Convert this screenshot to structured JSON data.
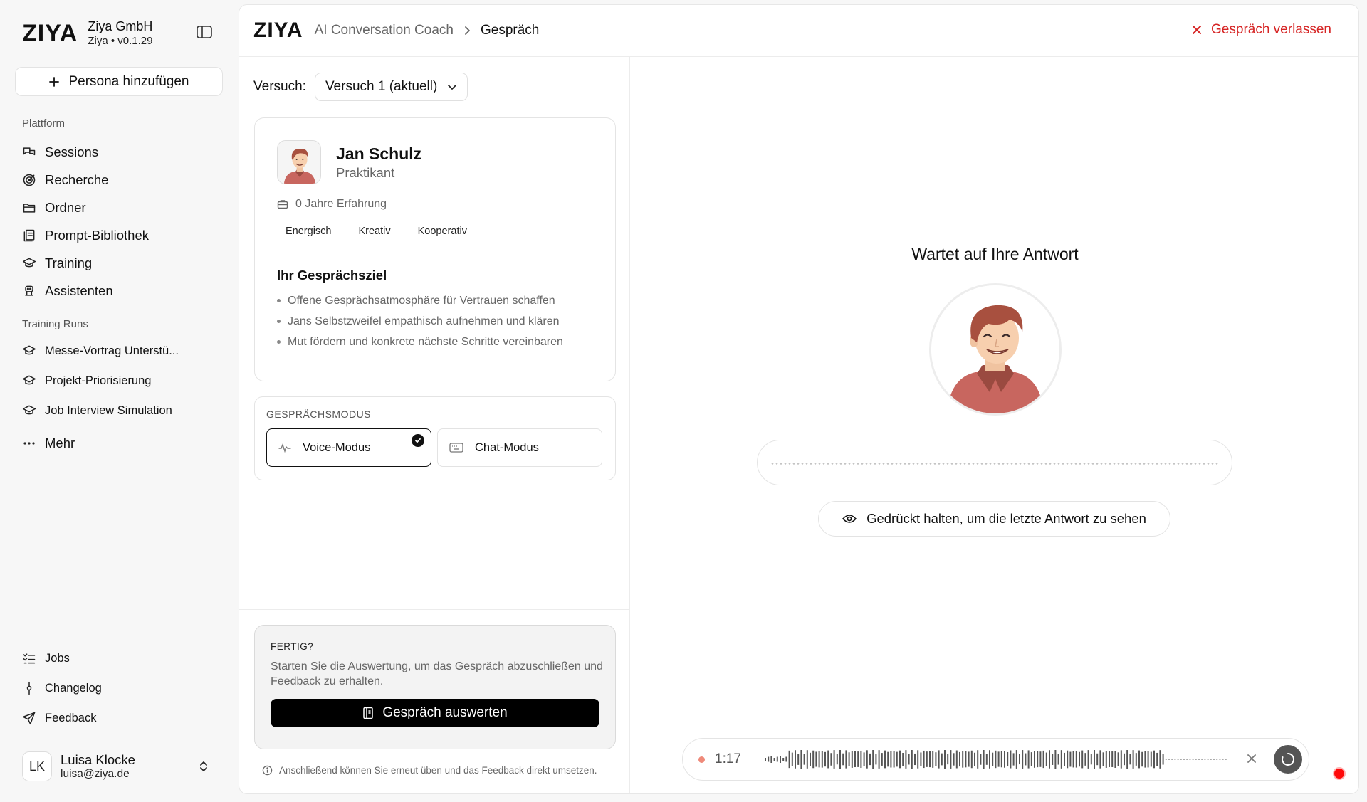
{
  "brand": {
    "logo": "ZIYA",
    "name": "Ziya GmbH",
    "sub": "Ziya • v0.1.29"
  },
  "sidebar": {
    "add_persona": "Persona hinzufügen",
    "platform_label": "Plattform",
    "platform_items": [
      {
        "label": "Sessions",
        "icon": "chat-bubbles-icon"
      },
      {
        "label": "Recherche",
        "icon": "target-icon"
      },
      {
        "label": "Ordner",
        "icon": "folder-icon"
      },
      {
        "label": "Prompt-Bibliothek",
        "icon": "library-icon"
      },
      {
        "label": "Training",
        "icon": "graduation-cap-icon"
      },
      {
        "label": "Assistenten",
        "icon": "bot-icon"
      }
    ],
    "runs_label": "Training Runs",
    "runs_items": [
      {
        "label": "Messe-Vortrag Unterstü..."
      },
      {
        "label": "Projekt-Priorisierung"
      },
      {
        "label": "Job Interview Simulation"
      },
      {
        "label": "Mehr"
      }
    ],
    "bottom_items": [
      {
        "label": "Jobs",
        "icon": "list-checks-icon"
      },
      {
        "label": "Changelog",
        "icon": "commit-icon"
      },
      {
        "label": "Feedback",
        "icon": "send-icon"
      }
    ],
    "user": {
      "initials": "LK",
      "name": "Luisa Klocke",
      "email": "luisa@ziya.de"
    }
  },
  "header": {
    "logo": "ZIYA",
    "breadcrumb": [
      "AI Conversation Coach",
      "Gespräch"
    ],
    "leave": "Gespräch verlassen"
  },
  "attempt": {
    "label": "Versuch:",
    "value": "Versuch 1 (aktuell)"
  },
  "persona": {
    "name": "Jan Schulz",
    "role": "Praktikant",
    "experience": "0 Jahre Erfahrung",
    "tags": [
      "Energisch",
      "Kreativ",
      "Kooperativ"
    ],
    "goal_title": "Ihr Gesprächsziel",
    "goals": [
      "Offene Gesprächsatmosphäre für Vertrauen schaffen",
      "Jans Selbstzweifel empathisch aufnehmen und klären",
      "Mut fördern und konkrete nächste Schritte vereinbaren"
    ]
  },
  "mode": {
    "label": "GESPRÄCHSMODUS",
    "voice": "Voice-Modus",
    "chat": "Chat-Modus",
    "selected": "voice"
  },
  "done": {
    "title": "FERTIG?",
    "text": "Starten Sie die Auswertung, um das Gespräch abzuschließen und Feedback zu erhalten.",
    "button": "Gespräch auswerten",
    "note": "Anschließend können Sie erneut üben und das Feedback direkt umsetzen."
  },
  "conversation": {
    "status": "Wartet auf Ihre Antwort",
    "hold_button": "Gedrückt halten, um die letzte Antwort zu sehen",
    "recording_time": "1:17"
  },
  "colors": {
    "accent_red": "#d62424",
    "primary": "#000000",
    "persona_shirt": "#c8665f",
    "persona_hair": "#a8503f"
  }
}
